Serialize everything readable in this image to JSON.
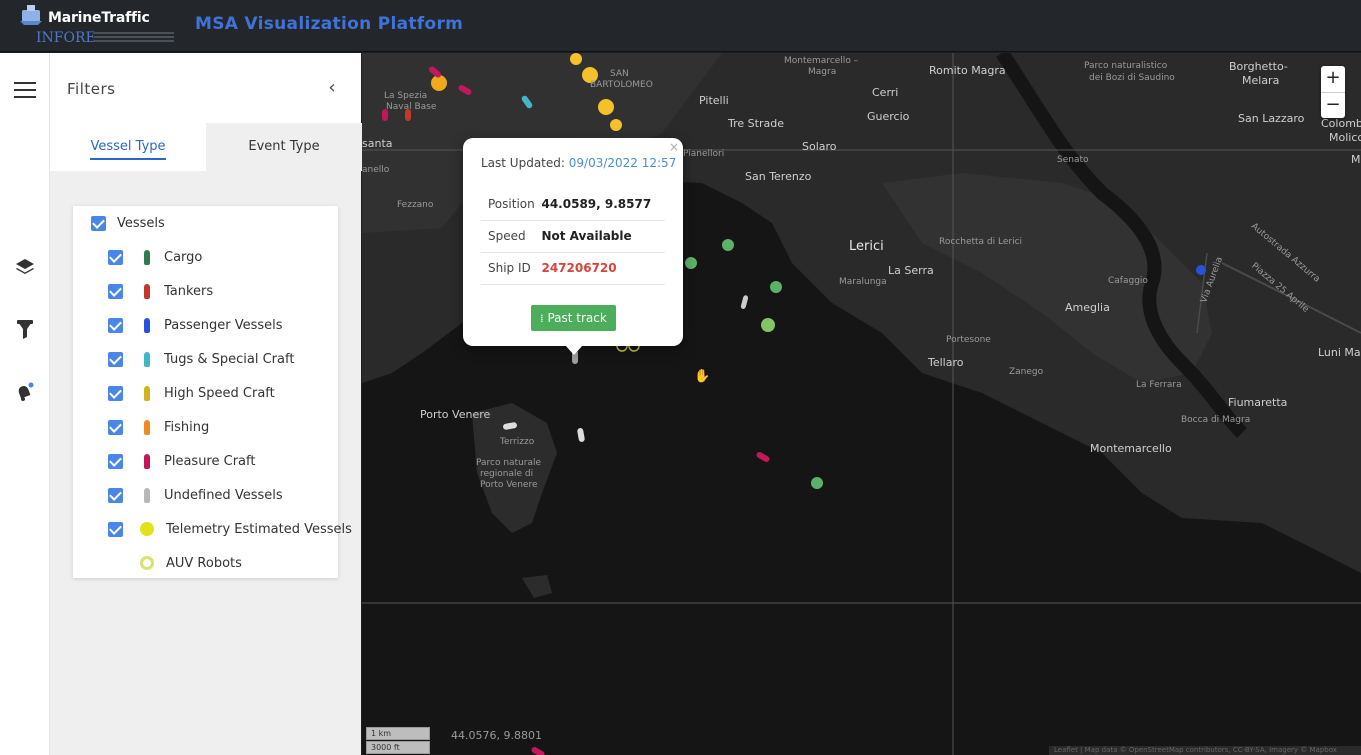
{
  "header": {
    "brand": "MarineTraffic",
    "sub_brand": "INFORE",
    "title": "MSA Visualization Platform"
  },
  "rail": {
    "icons": [
      "menu-icon",
      "layers-icon",
      "filter-icon",
      "alerts-icon"
    ]
  },
  "filters": {
    "title": "Filters",
    "tabs": [
      "Vessel Type",
      "Event Type"
    ],
    "active_tab": "Vessel Type",
    "vessels_label": "Vessels",
    "items": [
      {
        "label": "Cargo",
        "color": "#2e7d4f",
        "checked": true
      },
      {
        "label": "Tankers",
        "color": "#c0392b",
        "checked": true
      },
      {
        "label": "Passenger Vessels",
        "color": "#2952d9",
        "checked": true
      },
      {
        "label": "Tugs & Special Craft",
        "color": "#41b6c4",
        "checked": true
      },
      {
        "label": "High Speed Craft",
        "color": "#d4b21d",
        "checked": true
      },
      {
        "label": "Fishing",
        "color": "#f08a24",
        "checked": true
      },
      {
        "label": "Pleasure Craft",
        "color": "#c2185b",
        "checked": true
      },
      {
        "label": "Undefined Vessels",
        "color": "#b7b7b7",
        "checked": true
      },
      {
        "label": "Telemetry Estimated Vessels",
        "color": "#e3e01d",
        "checked": true
      },
      {
        "label": "AUV Robots",
        "color": "#d7e36a",
        "checked": false
      }
    ]
  },
  "map": {
    "places": [
      {
        "name": "Montemarcello –",
        "cls": "small"
      },
      {
        "name": "Magra",
        "cls": "small"
      },
      {
        "name": "Romito Magra",
        "cls": ""
      },
      {
        "name": "Parco naturalistico",
        "cls": "small"
      },
      {
        "name": "dei Bozi di Saudino",
        "cls": "small"
      },
      {
        "name": "Borghetto-",
        "cls": ""
      },
      {
        "name": "Melara",
        "cls": ""
      },
      {
        "name": "La Spezia",
        "cls": "small"
      },
      {
        "name": "Naval Base",
        "cls": "small"
      },
      {
        "name": "SAN",
        "cls": "small"
      },
      {
        "name": "BARTOLOMEO",
        "cls": "small"
      },
      {
        "name": "Cerri",
        "cls": ""
      },
      {
        "name": "Guercio",
        "cls": ""
      },
      {
        "name": "Pitelli",
        "cls": ""
      },
      {
        "name": "Tre Strade",
        "cls": ""
      },
      {
        "name": "Solaro",
        "cls": ""
      },
      {
        "name": "San Terenzo",
        "cls": ""
      },
      {
        "name": "Pianellori",
        "cls": "small"
      },
      {
        "name": "San Lazzaro",
        "cls": ""
      },
      {
        "name": "Colomb",
        "cls": ""
      },
      {
        "name": "Molicc",
        "cls": ""
      },
      {
        "name": "Senato",
        "cls": "small"
      },
      {
        "name": "Mol",
        "cls": ""
      },
      {
        "name": "Lerici",
        "cls": "big"
      },
      {
        "name": "Rocchetta di Lerici",
        "cls": "small"
      },
      {
        "name": "La Serra",
        "cls": ""
      },
      {
        "name": "Maralunga",
        "cls": "small"
      },
      {
        "name": "Cafaggio",
        "cls": "small"
      },
      {
        "name": "Ameglia",
        "cls": ""
      },
      {
        "name": "Portesone",
        "cls": "small"
      },
      {
        "name": "Tellaro",
        "cls": ""
      },
      {
        "name": "Zanego",
        "cls": "small"
      },
      {
        "name": "Luni Mare",
        "cls": ""
      },
      {
        "name": "La Ferrara",
        "cls": "small"
      },
      {
        "name": "Fiumaretta",
        "cls": ""
      },
      {
        "name": "Bocca di Magra",
        "cls": "small"
      },
      {
        "name": "Montemarcello",
        "cls": ""
      },
      {
        "name": "Porto Venere",
        "cls": ""
      },
      {
        "name": "Terrizzo",
        "cls": "small"
      },
      {
        "name": "Parco naturale",
        "cls": "small"
      },
      {
        "name": "regionale di",
        "cls": "small"
      },
      {
        "name": "Porto Venere",
        "cls": "small"
      },
      {
        "name": "Fezzano",
        "cls": "small"
      },
      {
        "name": "santa",
        "cls": ""
      },
      {
        "name": "anello",
        "cls": "small"
      },
      {
        "name": "Via Aurelia",
        "cls": "small"
      },
      {
        "name": "Autostrada Azzurra",
        "cls": "small"
      },
      {
        "name": "Piazza 25 Aprile",
        "cls": "small"
      }
    ],
    "popup": {
      "last_updated_label": "Last Updated:",
      "last_updated_value": "09/03/2022 12:57",
      "rows": [
        {
          "label": "Position",
          "value": "44.0589, 9.8577"
        },
        {
          "label": "Speed",
          "value": "Not Available"
        },
        {
          "label": "Ship ID",
          "value": "247206720"
        }
      ],
      "button": "Past track",
      "close": "×"
    },
    "scale": [
      "1 km",
      "3000 ft"
    ],
    "coords": "44.0576, 9.8801",
    "attribution": "Leaflet | Map data © OpenStreetMap contributors, CC-BY-SA, Imagery © Mapbox",
    "zoom_in": "+",
    "zoom_out": "−"
  }
}
